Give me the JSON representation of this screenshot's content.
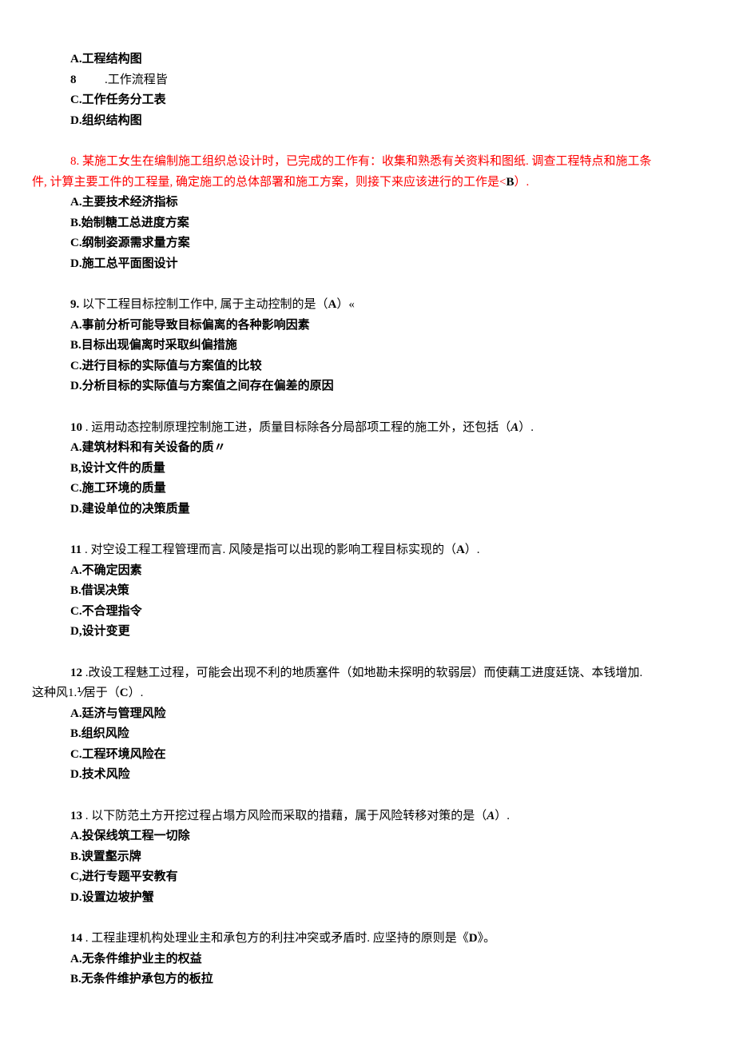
{
  "q7": {
    "optA": "A.工程结构图",
    "optB_label": "8",
    "optB_text": ".工作流程皆",
    "optC": "C.工作任务分工表",
    "optD": "D.组织结构图"
  },
  "q8": {
    "question_line1": "8. 某施工女生在编制施工组织总设计时，已完成的工作有：收集和熟悉有关资料和图纸. 调查工程特点和施工条",
    "question_line2_a": "件, 计算主要工件的工程量, 确定施工的总体部署和施工方案，则接下来应该进行的工作是<",
    "question_line2_b": "B",
    "question_line2_c": "）.",
    "optA": "A.主要技术经济指标",
    "optB": "B.始制糖工总进度方案",
    "optC": "C.纲制姿源需求量方案",
    "optD": "D.施工总平面图设计"
  },
  "q9": {
    "prefix": "9. ",
    "text_a": "以下工程目标控制工作中, 属于主动控制的是（",
    "answer": "A",
    "text_b": "）«",
    "optA": "A.事前分析可能导致目标偏离的各种影响因素",
    "optB": "B.目标出现偏离时采取纠偏措施",
    "optC": "C.进行目标的实际值与方案值的比较",
    "optD": "D.分析目标的实际值与方案值之间存在偏差的原因"
  },
  "q10": {
    "prefix": "10",
    "text_a": " . 运用动态控制原理控制施工进，质量目标除各分局部项工程的施工外，还包括（",
    "answer": "A",
    "text_b": "）.",
    "optA": "A.建筑材料和有关设备的质〃",
    "optB": "B,设计文件的质量",
    "optC": "C.施工环境的质量",
    "optD": "D.建设单位的决策质量"
  },
  "q11": {
    "prefix": "11",
    "text_a": " . 对空设工程工程管理而言. 风陵是指可以出现的影响工程目标实现的（",
    "answer": "A",
    "text_b": "）.",
    "optA": "A.不确定因素",
    "optB": "B.借误决策",
    "optC": "C.不合理指令",
    "optD": "D,设计变更"
  },
  "q12": {
    "prefix": "12",
    "line1": " .改设工程魅工过程，可能会出现不利的地质塞件（如地勘未探明的软弱层）而使藕工进度廷饶、本钱增加.",
    "line2_a": "这种风1.⅟居于（",
    "answer": "C",
    "line2_b": "）.",
    "optA": "A.廷济与管理风险",
    "optB": "B.组织风险",
    "optC": "C.工程环境风险在",
    "optD": "D.技术风险"
  },
  "q13": {
    "prefix": "13",
    "text_a": " . 以下防范土方开挖过程占塌方风险而采取的措藉，属于风险转移对策的是（",
    "answer": "A",
    "text_b": "）.",
    "optA": "A.投保线筑工程一切除",
    "optB": "B.谀置壑示牌",
    "optC": "C,进行专题平安教有",
    "optD": "D.设置边坡护蟹"
  },
  "q14": {
    "prefix": "14",
    "text_a": " . 工程韭理机构处理业主和承包方的利拄冲突或矛盾时. 应坚持的原则是《",
    "answer": "D",
    "text_b": "》。",
    "optA": "A.无条件维护业主的权益",
    "optB": "B.无条件维护承包方的板拉"
  }
}
